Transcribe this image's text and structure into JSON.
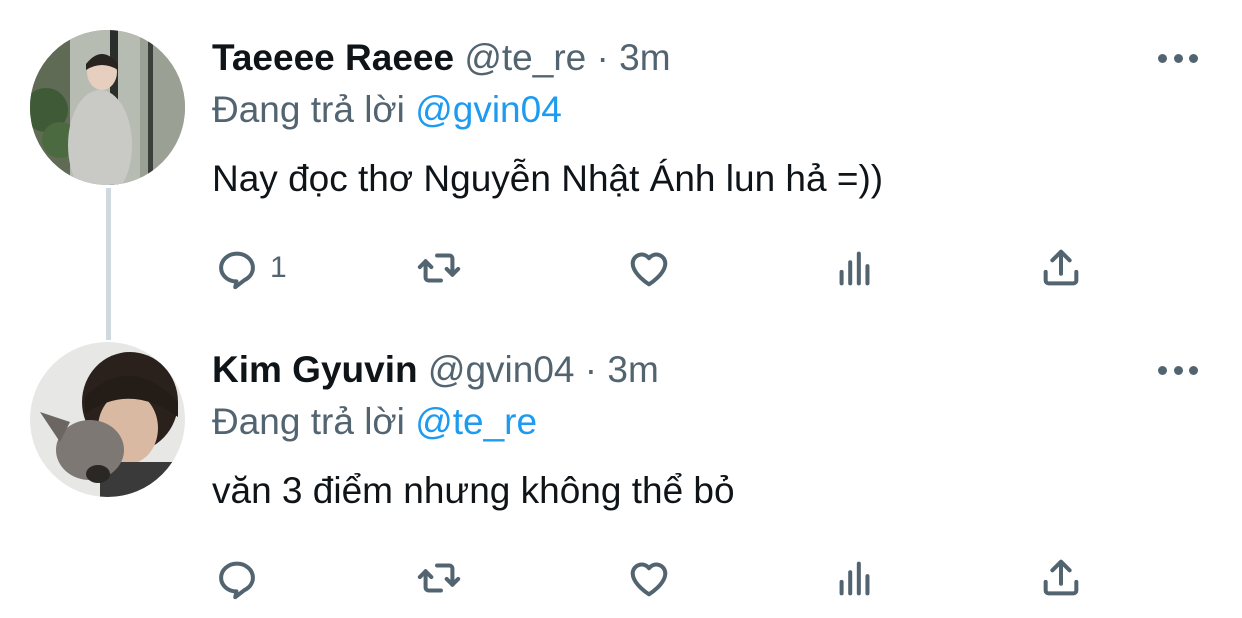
{
  "tweets": [
    {
      "name": "Taeeee Raeee",
      "handle": "@te_re",
      "separator": "·",
      "time": "3m",
      "reply_prefix": "Đang trả lời",
      "reply_to": "@gvin04",
      "text": "Nay đọc thơ Nguyễn Nhật Ánh lun hả =))",
      "reply_count": "1"
    },
    {
      "name": "Kim Gyuvin",
      "handle": "@gvin04",
      "separator": "·",
      "time": "3m",
      "reply_prefix": "Đang trả lời",
      "reply_to": "@te_re",
      "text": "văn 3 điểm nhưng không thể bỏ",
      "reply_count": ""
    }
  ],
  "icons": [
    "more-icon",
    "reply-icon",
    "retweet-icon",
    "like-icon",
    "views-icon",
    "share-icon"
  ],
  "colors": {
    "link": "#1d9bf0",
    "muted": "#536471",
    "text": "#0f1419",
    "thread_line": "#cfd9de"
  }
}
